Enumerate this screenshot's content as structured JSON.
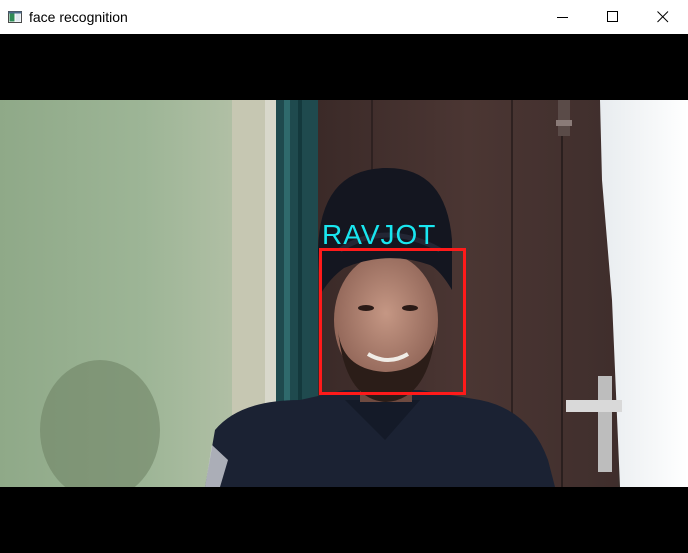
{
  "window": {
    "title": "face recognition",
    "icon": "app-window-icon",
    "controls": {
      "minimize_icon": "minimize-icon",
      "maximize_icon": "maximize-icon",
      "close_icon": "close-icon"
    }
  },
  "detection": {
    "label": "RAVJOT",
    "label_color": "#19e6f0",
    "box_color": "#ff1a1a"
  }
}
